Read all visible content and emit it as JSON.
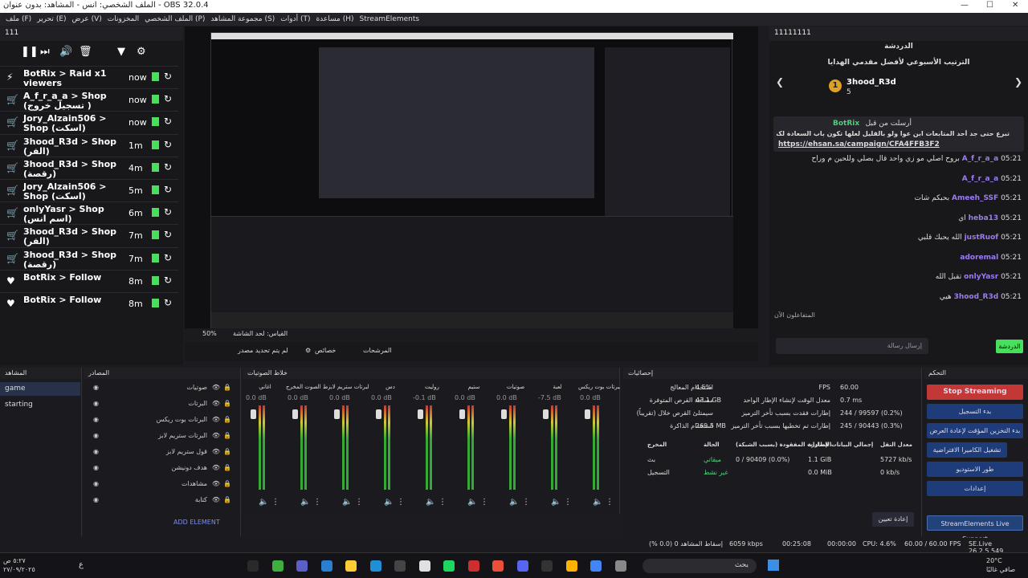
{
  "window": {
    "title": "الملف الشخصي: انس - المشاهد: بدون عنوان - OBS 32.0.4",
    "controls": {
      "min": "—",
      "max": "☐",
      "close": "✕"
    }
  },
  "menu": [
    "ملف (F)",
    "تحرير (E)",
    "عرض (V)",
    "المخزونات",
    "الملف الشخصي (P)",
    "مجموعة المشاهد (S)",
    "أدوات (T)",
    "مساعدة (H)",
    "StreamElements"
  ],
  "activity": {
    "title": "111",
    "items": [
      {
        "icon": "raid-icon",
        "text": "BotRix > Raid x1 viewers",
        "time": "now"
      },
      {
        "icon": "cart-icon",
        "text": "A_f_r_a_a > Shop (تسجيل خروج )",
        "time": "now"
      },
      {
        "icon": "cart-icon",
        "text": "Jory_Alzain506 > Shop (اسكت)",
        "time": "now"
      },
      {
        "icon": "cart-icon",
        "text": "3hood_R3d > Shop (الفر)",
        "time": "1m"
      },
      {
        "icon": "cart-icon",
        "text": "3hood_R3d > Shop (رقصة)",
        "time": "4m"
      },
      {
        "icon": "cart-icon",
        "text": "Jory_Alzain506 > Shop (اسكت)",
        "time": "5m"
      },
      {
        "icon": "cart-icon",
        "text": "onlyYasr > Shop (اسم انس)",
        "time": "6m"
      },
      {
        "icon": "cart-icon",
        "text": "3hood_R3d > Shop (الفر)",
        "time": "7m"
      },
      {
        "icon": "cart-icon",
        "text": "3hood_R3d > Shop (رقصة)",
        "time": "7m"
      },
      {
        "icon": "heart-icon",
        "text": "BotRix > Follow",
        "time": "8m"
      },
      {
        "icon": "heart-icon",
        "text": "BotRix > Follow",
        "time": "8m"
      }
    ]
  },
  "zoom": "50%",
  "preview_caption": "القياس: لحد الشاشة",
  "nosrc": "لم يتم تحديد مصدر",
  "props": "خصائص",
  "filters": "المرشحات",
  "chat": {
    "dock_title": "11111111",
    "tab": "الدردشة",
    "leader_title": "الترتيب الأسبوعي لأفضل مقدمي الهدايا",
    "leader_user": "3hood_R3d",
    "leader_n": "5",
    "pinned_user": "BotRix",
    "pinned_label": "أرسلت من قبل",
    "pinned_text": "تبرع حتى جد أحد المتابعات ابن عوا ولو بالقليل لعلها تكون باب السعادة لكم",
    "pinned_link": "https://ehsan.sa/campaign/CFA4FFB3F2",
    "lines": [
      {
        "user": "A_f_r_a_a",
        "text": "بروح اصلي مو زي واحد قال بصلي وللحين م وراح",
        "time": "05:21"
      },
      {
        "user": "A_f_r_a_a",
        "text": "",
        "time": "05:21"
      },
      {
        "user": "Ameeh_SSF",
        "text": "بحبكم شات",
        "time": "05:21"
      },
      {
        "user": "heba13",
        "text": "اي",
        "time": "05:21"
      },
      {
        "user": "justRuof",
        "text": "الله يحبك قلبي",
        "time": "05:21"
      },
      {
        "user": "adoremal",
        "text": "",
        "time": "05:21"
      },
      {
        "user": "onlyYasr",
        "text": "تقبل الله",
        "time": "05:21"
      },
      {
        "user": "3hood_R3d",
        "text": "هيي",
        "time": "05:21"
      }
    ],
    "viewers": "المتفاعلون الآن",
    "input_placeholder": "إرسال رسالة",
    "send": "الدردشة"
  },
  "scenes": {
    "title": "المشاهد",
    "items": [
      "game",
      "starting"
    ]
  },
  "sources": {
    "title": "المصادر",
    "items": [
      "صوتيات",
      "البرتات",
      "البرتات بوت ريكس",
      "البرتات ستريم لابز",
      "قول ستريم لابز",
      "هدف دونيشن",
      "مشاهدات",
      "كتابة"
    ],
    "add": "ADD ELEMENT"
  },
  "mixer": {
    "title": "خلاط الصوتيات",
    "channels": [
      {
        "name": "البرتات بوت ريكس",
        "db": "0.0 dB"
      },
      {
        "name": "لعبة",
        "db": "-7.5 dB"
      },
      {
        "name": "صوتيات",
        "db": "0.0 dB"
      },
      {
        "name": "ستيم",
        "db": "0.0 dB"
      },
      {
        "name": "روليت",
        "db": "-0.1 dB"
      },
      {
        "name": "دس",
        "db": "0.0 dB"
      },
      {
        "name": "البرتات ستريم لابز",
        "db": "0.0 dB"
      },
      {
        "name": "التقاط الصوت المخرج",
        "db": "0.0 dB"
      },
      {
        "name": "اغاني",
        "db": "0.0 dB"
      }
    ],
    "scale": [
      "0",
      "-5",
      "-10",
      "-15",
      "-20",
      "-25",
      "-30",
      "-35",
      "-40",
      "-45",
      "-50",
      "-55",
      "-60"
    ]
  },
  "stats": {
    "title": "إحصائيات",
    "rows": [
      {
        "label": "استخدام المعالج",
        "val": "4.5%",
        "label2": "FPS",
        "val2": "60.00"
      },
      {
        "label": "مساحة القرص المتوفرة",
        "val": "43.1 GB",
        "label2": "معدل الوقت لإنشاء الإطار الواحد",
        "val2": "0.7 ms"
      },
      {
        "label": "سيمتلئ القرص خلال (تقريباً)",
        "val": "",
        "label2": "إطارات فقدت بسبب تأخر الترميز",
        "val2": "244 / 99597 (0.2%)"
      },
      {
        "label": "استخدام الذاكرة",
        "val": "269.5 MB",
        "label2": "إطارات تم تخطيها بسبب تأخر الترميز",
        "val2": "245 / 90443 (0.3%)"
      }
    ],
    "out_header": [
      "المخرج",
      "الحالة",
      "الإطارات المفقودة (بسبب الشبكة)",
      "إجمالي البيانات الصادرة",
      "معدل النقل"
    ],
    "out_rows": [
      [
        "بث",
        "ميقاتي",
        "0 / 90409 (0.0%)",
        "1.1 GiB",
        "5727 kb/s"
      ],
      [
        "التسجيل",
        "غير نشط",
        "",
        "0.0 MiB",
        "0 kb/s"
      ]
    ],
    "reset": "إعادة تعيين"
  },
  "controls": {
    "title": "التحكم",
    "stop": "Stop Streaming",
    "rec": "بدء التسجيل",
    "replay": "بدء التخزين المؤقت لإعادة العرض",
    "vcam": "تشغيل الكاميرا الافتراضية",
    "studio": "طور الاستوديو",
    "settings": "إعدادات",
    "se": "StreamElements Live Support"
  },
  "status": {
    "dropped": "إسقاط المشاهد 0 (0.0 %)",
    "kbps": "6059 kbps",
    "stream_time": "00:25:08",
    "rec_time": "00:00:00",
    "cpu": "CPU: 4.6%",
    "fps": "60.00 / 60.00 FPS",
    "se": "SE.Live 26.2.5.549"
  },
  "taskbar": {
    "search": "بحث",
    "weather_temp": "20°C",
    "weather": "صافي غالبًا",
    "time": "٥:٢٧ ص",
    "date": "٢٧/٠٩/٢٠٢٥",
    "lang": "ع"
  },
  "colors": {
    "accent_blue": "#1e3b7a",
    "stop_red": "#c33737",
    "green": "#47e05b"
  }
}
